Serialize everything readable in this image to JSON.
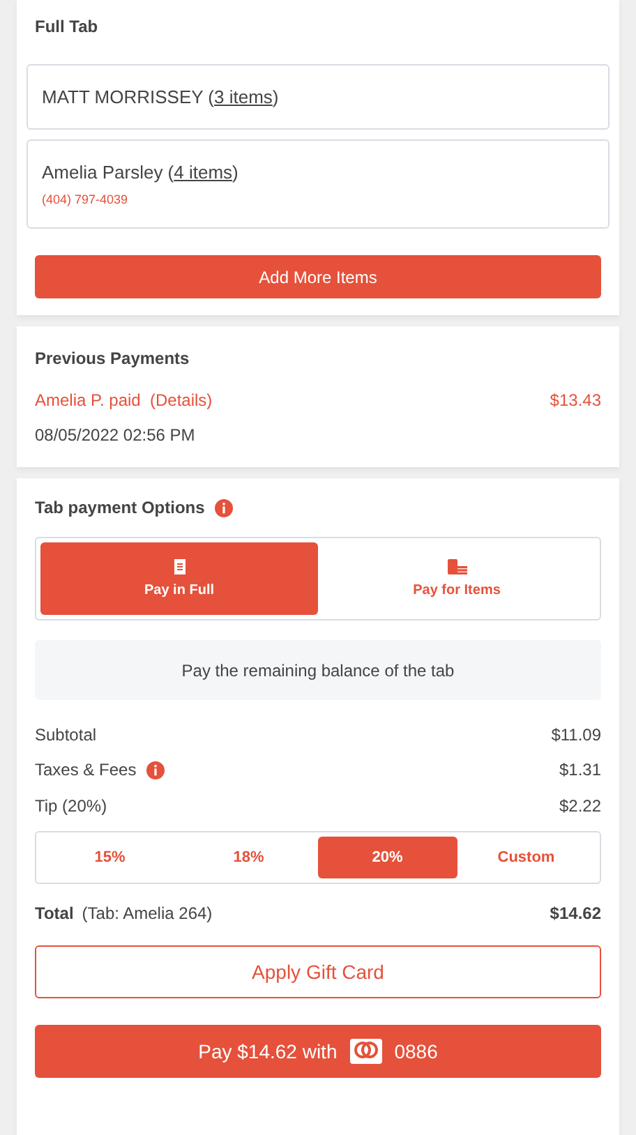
{
  "full_tab": {
    "title": "Full Tab",
    "guests": [
      {
        "name": "MATT MORRISSEY",
        "items": "(3 items)"
      },
      {
        "name": "Amelia Parsley",
        "items": "(4 items)",
        "phone": "(404) 797-4039"
      }
    ],
    "add_button": "Add More Items"
  },
  "previous_payments": {
    "title": "Previous Payments",
    "payments": [
      {
        "label": "Amelia P. paid",
        "details": "(Details)",
        "amount": "$13.43",
        "date": "08/05/2022 02:56 PM"
      }
    ]
  },
  "payment_options": {
    "title": "Tab payment Options",
    "modes": [
      {
        "label": "Pay in Full",
        "kind": "full",
        "selected": true
      },
      {
        "label": "Pay for Items",
        "kind": "items",
        "selected": false
      }
    ],
    "note": "Pay the remaining balance of the tab",
    "lines": [
      {
        "label": "Subtotal",
        "amount": "$11.09",
        "info": false
      },
      {
        "label": "Taxes & Fees",
        "amount": "$1.31",
        "info": true
      },
      {
        "label": "Tip (20%)",
        "amount": "$2.22",
        "info": false
      }
    ],
    "tips": [
      {
        "label": "15%",
        "selected": false
      },
      {
        "label": "18%",
        "selected": false
      },
      {
        "label": "20%",
        "selected": true
      },
      {
        "label": "Custom",
        "selected": false
      }
    ],
    "total": {
      "label": "Total",
      "tab": "(Tab: Amelia 264)",
      "amount": "$14.62"
    },
    "gift_card_button": "Apply Gift Card",
    "pay_button": {
      "text": "Pay $14.62 with",
      "card_last4": "0886"
    }
  }
}
